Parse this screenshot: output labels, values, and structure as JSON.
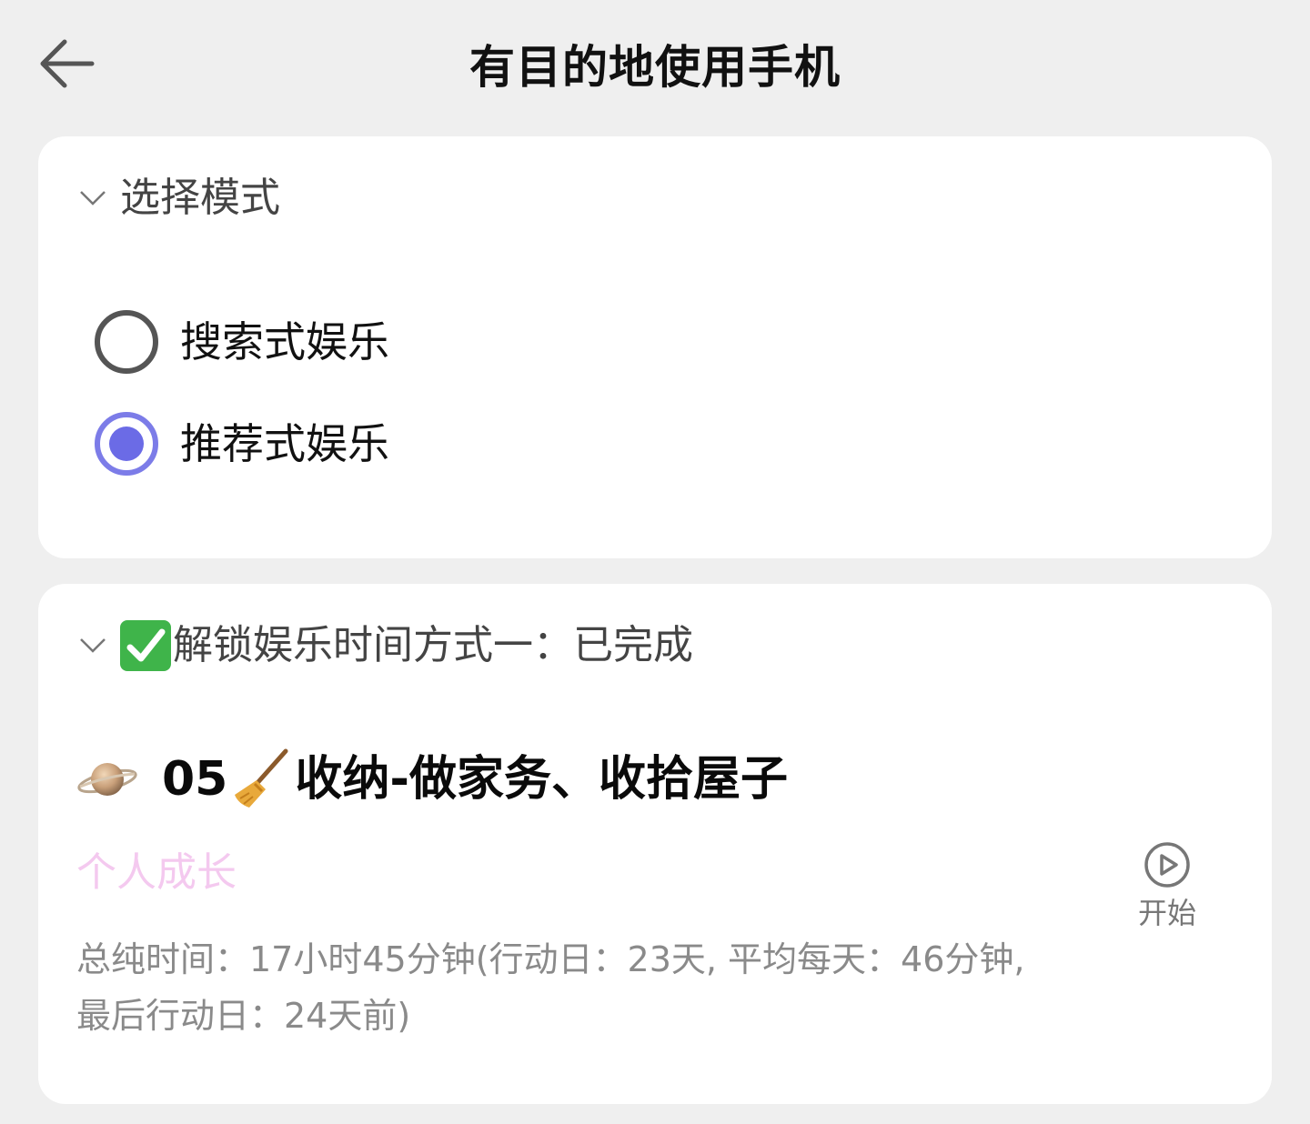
{
  "header": {
    "title": "有目的地使用手机",
    "back_icon": "arrow-left-icon"
  },
  "mode_section": {
    "title": "选择模式",
    "options": [
      {
        "label": "搜索式娱乐",
        "selected": false
      },
      {
        "label": "推荐式娱乐",
        "selected": true
      }
    ]
  },
  "unlock_section": {
    "title": "解锁娱乐时间方式一：已完成",
    "status_icon": "check-mark-icon",
    "task": {
      "number": "05",
      "title": "收纳-做家务、收拾屋子",
      "planet_icon": "ringed-planet-icon",
      "broom_icon": "broom-icon",
      "category": "个人成长",
      "stats_line1": "总纯时间：17小时45分钟(行动日：23天, 平均每天：46分钟,",
      "stats_line2": "最后行动日：24天前)",
      "start_label": "开始"
    }
  },
  "colors": {
    "background": "#efefef",
    "card": "#ffffff",
    "accent": "#6b6be6",
    "category": "#f4c9ef",
    "check": "#3fb44a"
  }
}
